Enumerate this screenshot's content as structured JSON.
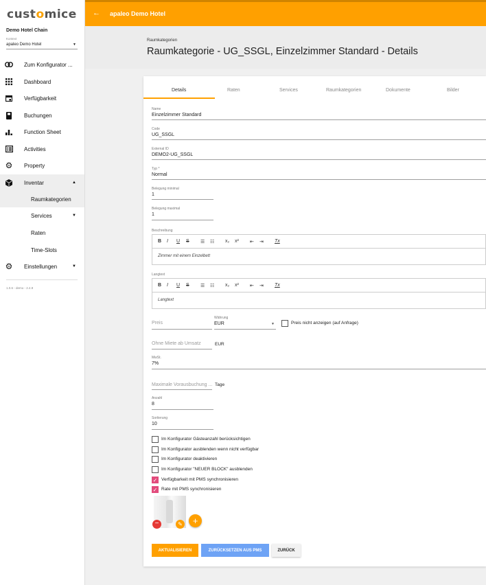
{
  "brand": {
    "logo_a": "cust",
    "logo_o": "o",
    "logo_b": "mice"
  },
  "sidebar": {
    "context_title": "Demo Hotel Chain",
    "context_label": "Kontext",
    "context_value": "apaleo Demo Hotel",
    "items": [
      {
        "label": "Zum Konfigurator ...",
        "icon": "link-icon"
      },
      {
        "label": "Dashboard",
        "icon": "grid-icon"
      },
      {
        "label": "Verfügbarkeit",
        "icon": "calendar-icon"
      },
      {
        "label": "Buchungen",
        "icon": "book-icon"
      },
      {
        "label": "Function Sheet",
        "icon": "bar-chart-icon"
      },
      {
        "label": "Activities",
        "icon": "list-alt-icon"
      },
      {
        "label": "Property",
        "icon": "gear-icon"
      },
      {
        "label": "Inventar",
        "icon": "cube-icon"
      },
      {
        "label": "Raumkategorien"
      },
      {
        "label": "Services"
      },
      {
        "label": "Raten"
      },
      {
        "label": "Time-Slots"
      },
      {
        "label": "Einstellungen",
        "icon": "gear-icon"
      }
    ],
    "version": "1.0.6 - demo - 2.4.9"
  },
  "topbar": {
    "back": "←",
    "title": "apaleo Demo Hotel"
  },
  "header": {
    "breadcrumb": "Raumkategorien",
    "title": "Raumkategorie - UG_SSGL, Einzelzimmer Standard - Details"
  },
  "tabs": [
    "Details",
    "Raten",
    "Services",
    "Raumkategorien",
    "Dokumente",
    "Bilder"
  ],
  "form": {
    "name": {
      "label": "Name",
      "value": "Einzelzimmer Standard"
    },
    "code": {
      "label": "Code",
      "value": "UG_SSGL"
    },
    "external": {
      "label": "External ID",
      "value": "DEMO2-UG_SSGL"
    },
    "typ": {
      "label": "Typ *",
      "value": "Normal"
    },
    "bel_min": {
      "label": "Belegung minimal",
      "value": "1"
    },
    "bel_max": {
      "label": "Belegung maximal",
      "value": "1"
    },
    "beschreibung": {
      "label": "Beschreibung",
      "text": "Zimmer mit einem Einzelbett"
    },
    "langtext": {
      "label": "Langtext",
      "text": "Langtext"
    },
    "toolbar": {
      "b": "B",
      "i": "I",
      "u": "U",
      "s": "S",
      "ol": "☰",
      "ul": "☷",
      "sub": "x₂",
      "sup": "x²",
      "indl": "⇤",
      "indr": "⇥",
      "clear": "Tx"
    },
    "preis": {
      "placeholder": "Preis"
    },
    "waehrung": {
      "label": "Währung",
      "value": "EUR"
    },
    "preis_nicht": "Preis nicht anzeigen (auf Anfrage)",
    "ohne_miete": {
      "placeholder": "Ohne Miete ab Umsatz",
      "unit": "EUR"
    },
    "mwst": {
      "label": "MwSt.",
      "value": "7%"
    },
    "max_voraus": {
      "placeholder": "Maximale Vorausbuchung ...",
      "unit": "Tage"
    },
    "anzahl": {
      "label": "Anzahl",
      "value": "8"
    },
    "sortierung": {
      "label": "Sortierung",
      "value": "10"
    }
  },
  "checkboxes": [
    {
      "label": "Im Konfigurator Gästeanzahl berücksichtigen",
      "checked": false
    },
    {
      "label": "Im Konfigurator ausblenden wenn nicht verfügbar",
      "checked": false
    },
    {
      "label": "Im Konfigurator deaktivieren",
      "checked": false
    },
    {
      "label": "Im Konfigurator \"NEUER BLOCK\" ausblenden",
      "checked": false
    },
    {
      "label": "Verfügbarkeit mit PMS synchronisieren",
      "checked": true
    },
    {
      "label": "Rate mit PMS synchronisieren",
      "checked": true
    }
  ],
  "image": {
    "remove": "−",
    "edit": "✎",
    "add": "+"
  },
  "buttons": {
    "update": "AKTUALISIEREN",
    "reset": "ZURÜCKSETZEN AUS PMS",
    "back": "ZURÜCK"
  },
  "colors": {
    "accent": "#ffa000",
    "blue": "#6ea3f5",
    "pink": "#e24b7c",
    "red": "#e53935"
  }
}
